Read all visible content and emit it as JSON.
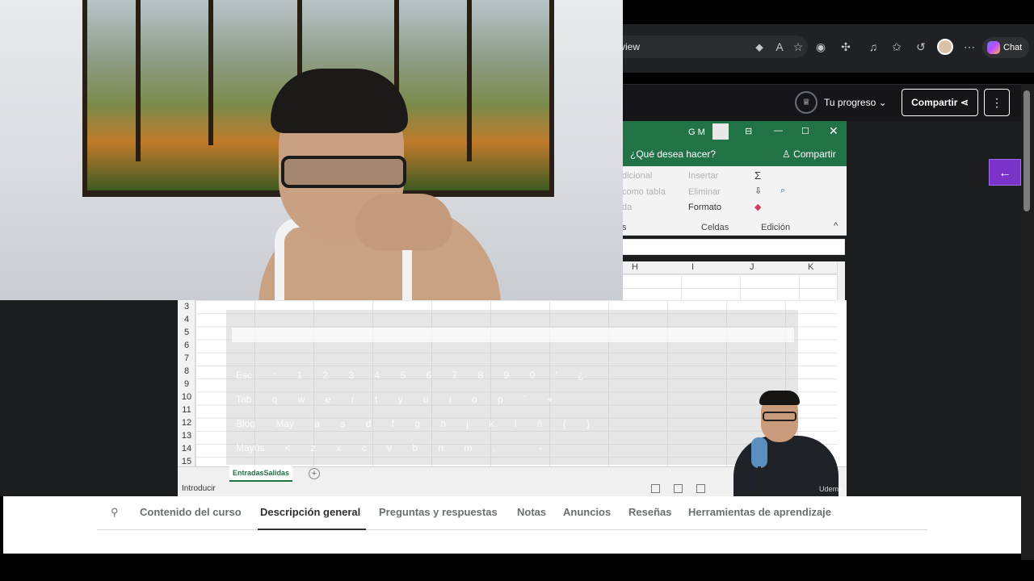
{
  "browser": {
    "url_fragment": "view",
    "chat_label": "Chat"
  },
  "course_header": {
    "progress_label": "Tu progreso",
    "share_label": "Compartir",
    "more_label": "⋮"
  },
  "excel": {
    "user_initials": "G M",
    "tell_me": "¿Qué desea hacer?",
    "share_label": "Compartir",
    "ribbon": {
      "cond_format": "dicional",
      "as_table": "como tabla",
      "styles_fragment": "da",
      "insert": "Insertar",
      "delete": "Eliminar",
      "format": "Formato",
      "cells_group": "Celdas",
      "editing_group": "Edición",
      "styles_group": "s"
    },
    "columns": [
      "H",
      "I",
      "J",
      "K"
    ],
    "rows": [
      "3",
      "4",
      "5",
      "6",
      "7",
      "8",
      "9",
      "10",
      "11",
      "12",
      "13",
      "14",
      "15"
    ],
    "sheet_tab": "EntradasSalidas",
    "status": "Introducir",
    "keyboard_rows": [
      "Esc ° 1 2 3 4 5 6 7 8 9 0 ' ¿",
      "Tab q w e r t y u i o p ´ +",
      "Bloq May a s d f g h j k l ñ { }",
      "Mayús < z x c v b n m , . -"
    ]
  },
  "watermark": "Udemy",
  "course_tabs": [
    {
      "label": "Contenido del curso",
      "active": false
    },
    {
      "label": "Descripción general",
      "active": true
    },
    {
      "label": "Preguntas y respuestas",
      "active": false
    },
    {
      "label": "Notas",
      "active": false
    },
    {
      "label": "Anuncios",
      "active": false
    },
    {
      "label": "Reseñas",
      "active": false
    },
    {
      "label": "Herramientas de aprendizaje",
      "active": false
    }
  ],
  "colors": {
    "excel_green": "#217346",
    "udemy_purple": "#7a32c9",
    "header_dark": "#16161a"
  },
  "icons": [
    "search-icon",
    "trophy-icon",
    "share-icon",
    "arrow-left-icon",
    "star-icon",
    "chat-logo-icon"
  ]
}
